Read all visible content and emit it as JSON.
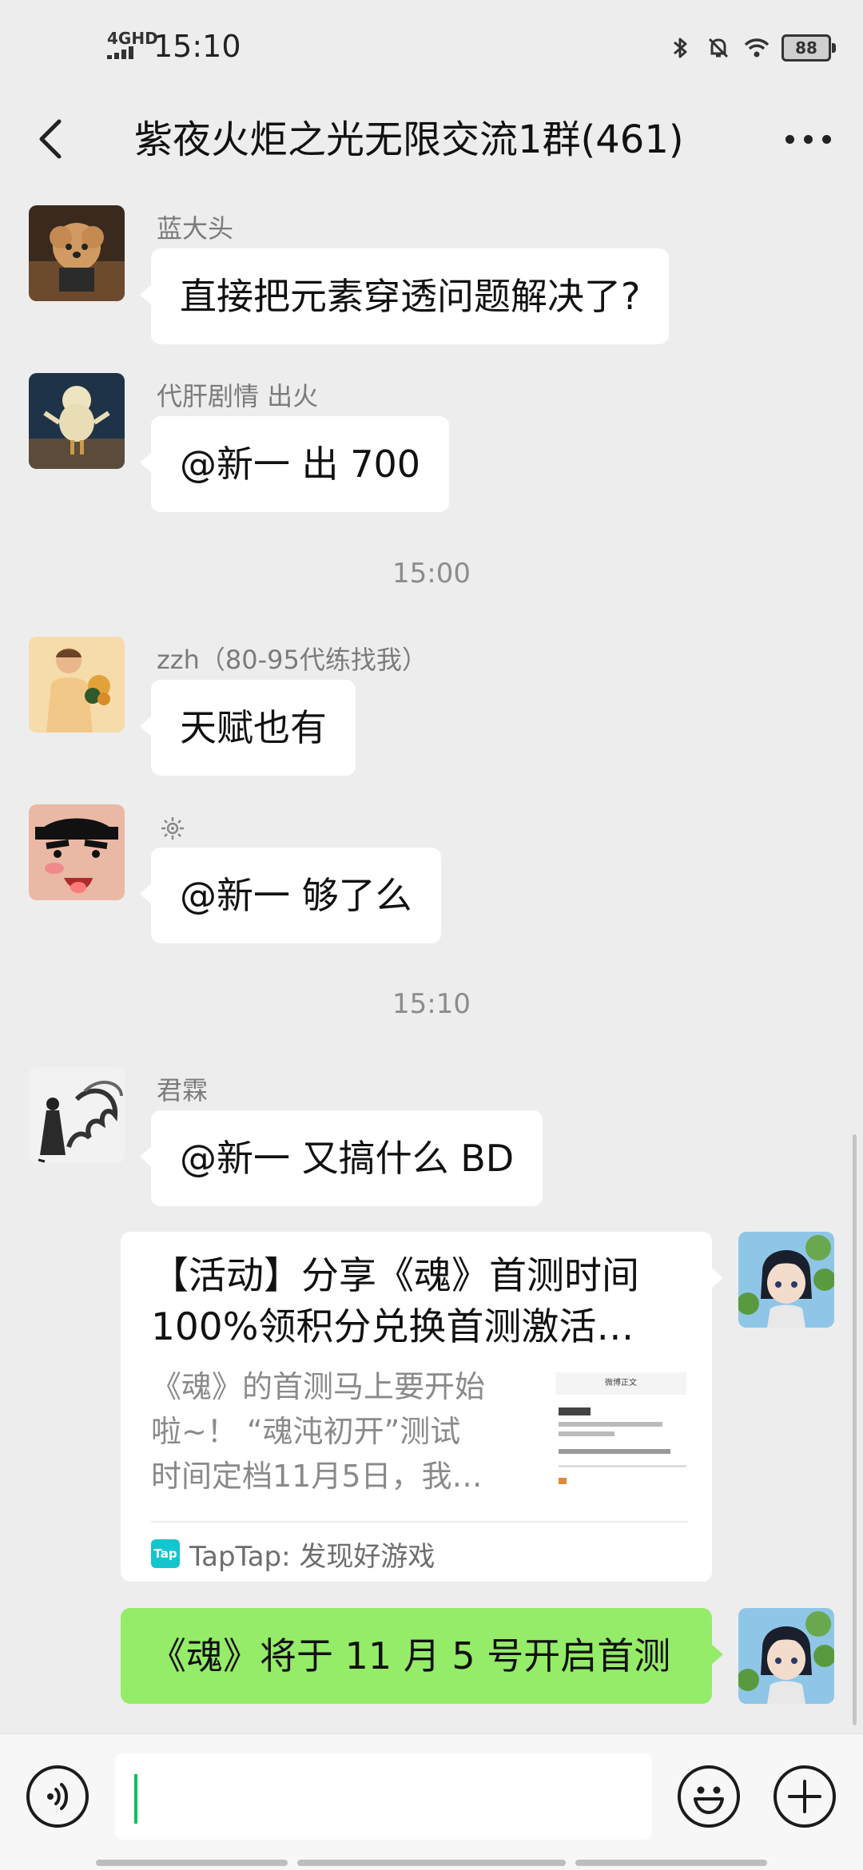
{
  "status_bar": {
    "network": "4GHD",
    "time": "15:10",
    "battery": "88"
  },
  "header": {
    "title": "紫夜火炬之光无限交流1群(461)"
  },
  "messages": [
    {
      "sender": "蓝大头",
      "text": "直接把元素穿透问题解决了?"
    },
    {
      "sender": "代肝剧情 出火",
      "text": "@新一  出 700"
    },
    {
      "sender": "zzh（80-95代练找我）",
      "text": "天赋也有"
    },
    {
      "sender": "",
      "text": "@新一  够了么"
    },
    {
      "sender": "君霖",
      "text": "@新一  又搞什么 BD"
    }
  ],
  "timestamps": [
    "15:00",
    "15:10"
  ],
  "link_card": {
    "title_line1": "【活动】分享《魂》首测时间",
    "title_line2": "100%领积分兑换首测激活…",
    "desc_line1": "《魂》的首测马上要开始",
    "desc_line2": "啦~！ “魂沌初开”测试",
    "desc_line3": "时间定档11月5日，我…",
    "source": "TapTap: 发现好游戏",
    "source_logo": "Tap",
    "thumb_title": "微博正文"
  },
  "my_message": "《魂》将于 11 月 5 号开启首测",
  "colors": {
    "background": "#ededed",
    "bubble": "#ffffff",
    "my_bubble": "#95ec69",
    "caret": "#07c160"
  },
  "icons": [
    "back-arrow-icon",
    "more-icon",
    "voice-icon",
    "emoji-icon",
    "plus-icon",
    "bluetooth-icon",
    "mute-icon",
    "wifi-icon"
  ]
}
